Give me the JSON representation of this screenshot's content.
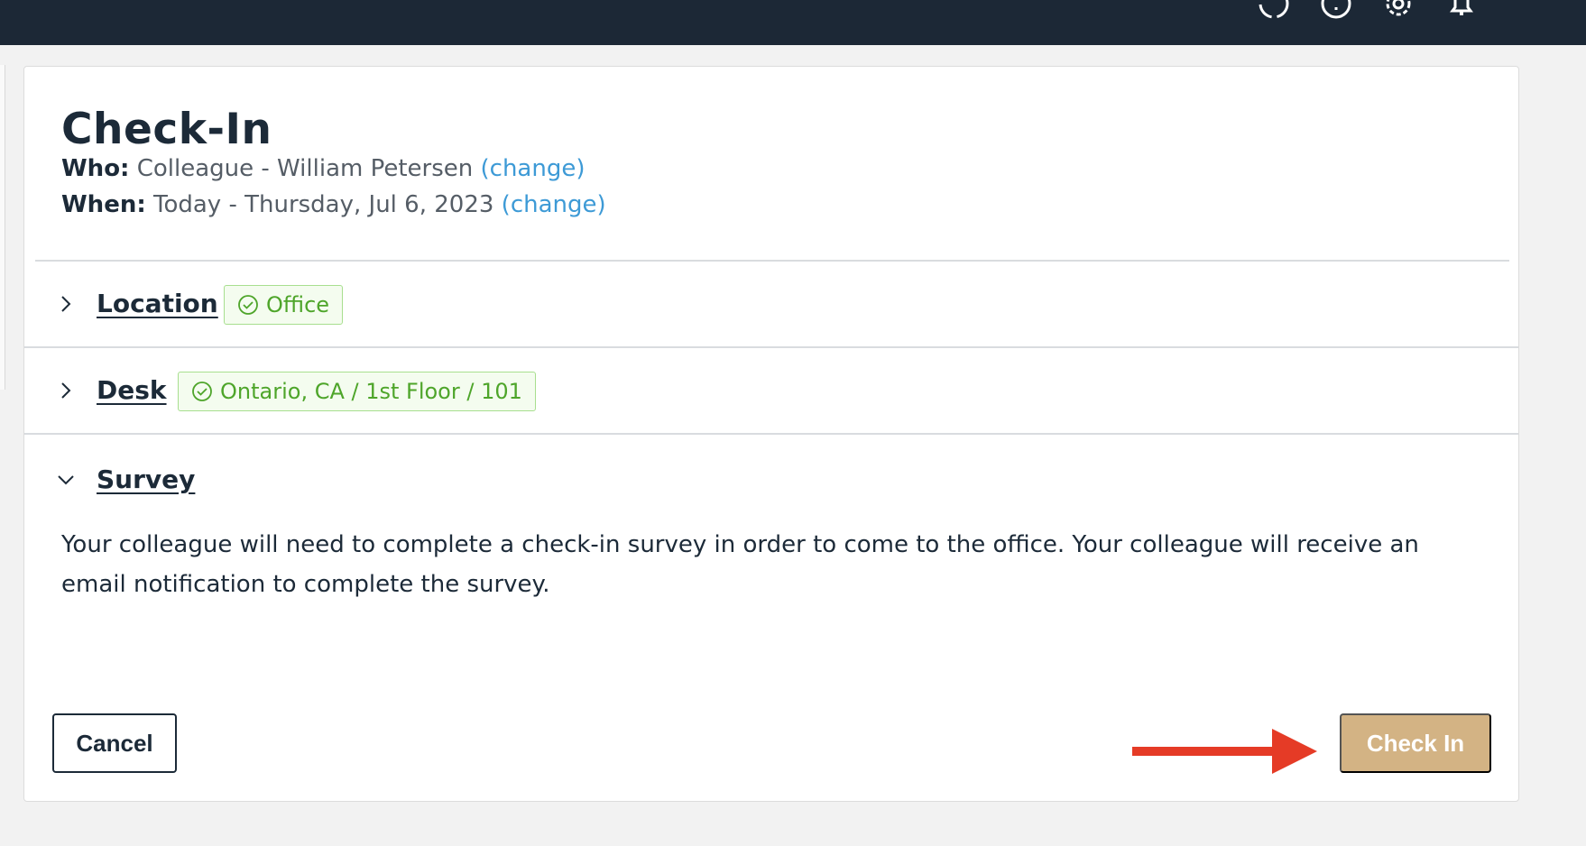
{
  "header": {
    "icons": [
      "sync-icon",
      "info-icon",
      "gear-icon",
      "bell-icon"
    ]
  },
  "page": {
    "title": "Check-In",
    "who_label": "Who:",
    "who_value": "Colleague - William Petersen",
    "who_change": "(change)",
    "when_label": "When:",
    "when_value": "Today - Thursday, Jul 6, 2023",
    "when_change": "(change)"
  },
  "sections": {
    "location": {
      "title": "Location",
      "badge": "Office",
      "expanded": false
    },
    "desk": {
      "title": "Desk",
      "badge": "Ontario, CA / 1st Floor / 101",
      "expanded": false
    },
    "survey": {
      "title": "Survey",
      "expanded": true,
      "text": "Your colleague will need to complete a check-in survey in order to come to the office. Your colleague will receive an email notification to complete the survey."
    }
  },
  "actions": {
    "cancel_label": "Cancel",
    "checkin_label": "Check In"
  },
  "colors": {
    "topbar": "#1c2836",
    "link": "#3d9ad6",
    "badge_green": "#4ea52a",
    "checkin_button": "#d3b384",
    "annotation_arrow": "#e53b26"
  }
}
